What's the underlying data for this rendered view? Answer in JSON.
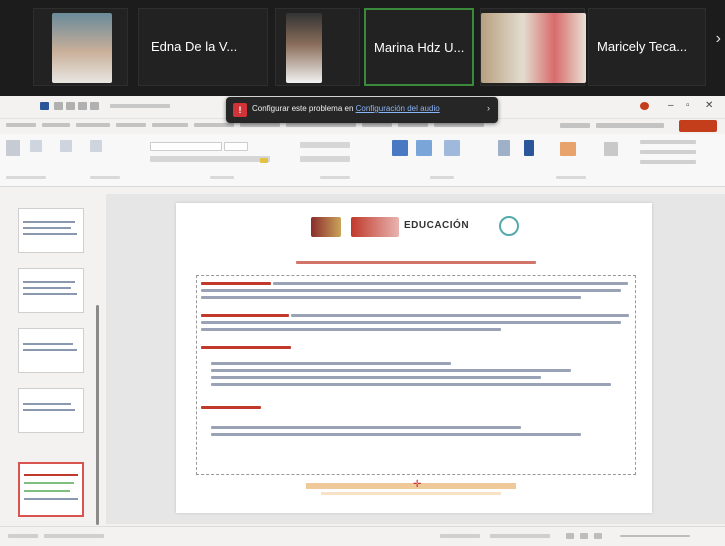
{
  "meeting": {
    "participants": [
      {
        "name": "Edna De la V..."
      },
      {
        "name": "Marina Hdz U..."
      },
      {
        "name": "Maricely Teca..."
      }
    ],
    "next_icon": "chevron-right-icon"
  },
  "notification": {
    "text": "Configurar este problema en",
    "link": "Configuración del audio"
  },
  "slide": {
    "logo_text": "EDUCACIÓN"
  },
  "colors": {
    "meeting_bg": "#1c1c1c",
    "accent": "#c43e1c",
    "slide_heading": "#c0392b"
  }
}
